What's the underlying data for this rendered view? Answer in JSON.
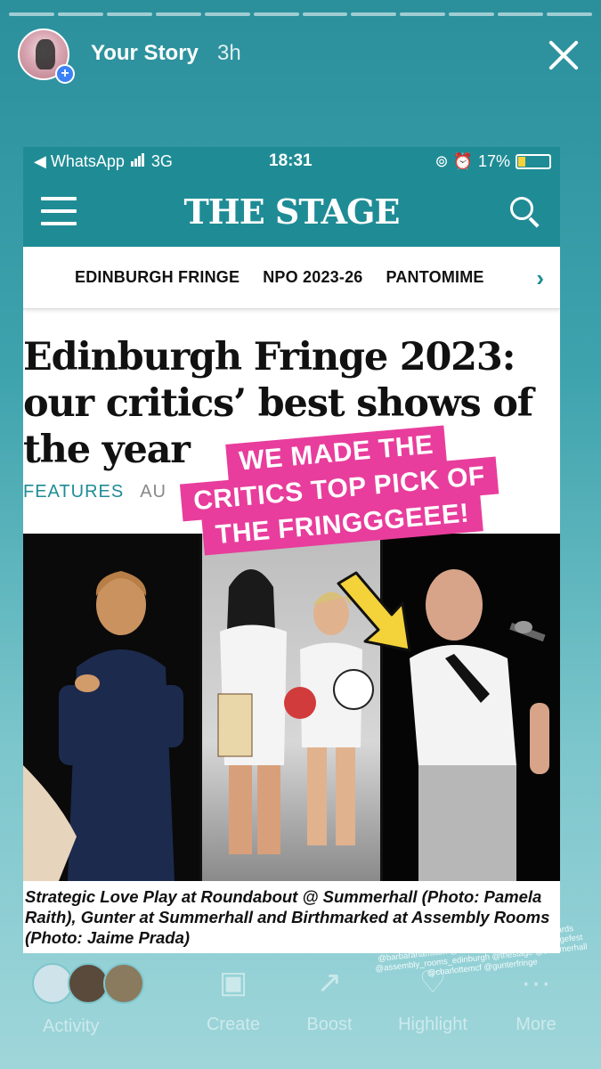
{
  "story": {
    "title": "Your Story",
    "time": "3h",
    "segments": 12
  },
  "screenshot": {
    "status_bar": {
      "back_app": "◀ WhatsApp",
      "network": "3G",
      "time": "18:31",
      "battery": "17%",
      "status_icons": "⊚ ⏰"
    },
    "site": {
      "brand": "THE STAGE",
      "categories": [
        "EDINBURGH FRINGE",
        "NPO 2023-26",
        "PANTOMIME"
      ],
      "next_chevron": "›"
    },
    "article": {
      "headline": "Edinburgh Fringe 2023: our critics’ best shows of the year",
      "section": "FEATURES",
      "date": "AU",
      "caption": "Strategic Love Play at Roundabout @ Summerhall (Photo: Pamela Raith), Gunter at Summerhall and Birthmarked at Assembly Rooms (Photo: Jaime Prada)"
    }
  },
  "sticker": {
    "lines": [
      "WE MADE THE",
      "CRITICS TOP PICK OF",
      "THE FRINGGGEEE!"
    ],
    "color": "#e83d9c",
    "arrow_color": "#f4d23a"
  },
  "tags_text": "@annaclarkfsc @caitlinanacadem @hemiedwards @barbarahamilton @moverson_edinburgh @fringefest @assembly_rooms_edinburgh @thestage @summerhall @charlottemcf @gunterfringe",
  "bottom_bar": {
    "activity": "Activity",
    "create": "Create",
    "boost": "Boost",
    "highlight": "Highlight",
    "more": "More"
  },
  "colors": {
    "accent_teal": "#1f8c95",
    "background_top": "#2b8f9c",
    "background_bottom": "#9fd6da"
  }
}
